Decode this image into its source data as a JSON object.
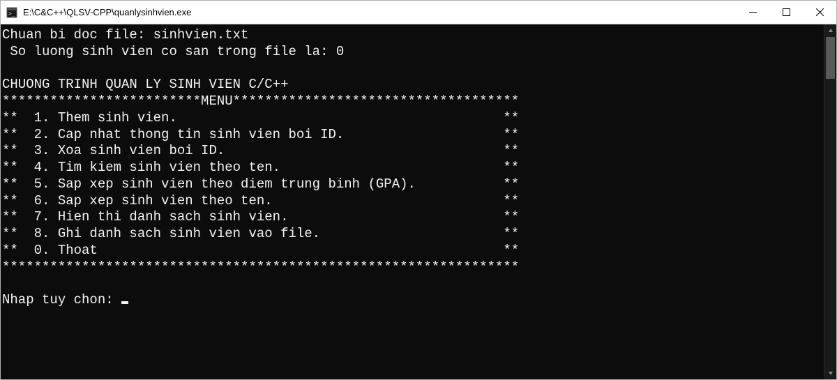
{
  "window": {
    "title": "E:\\C&C++\\QLSV-CPP\\quanlysinhvien.exe"
  },
  "console": {
    "line_prepare": "Chuan bi doc file: sinhvien.txt",
    "line_count": " So luong sinh vien co san trong file la: 0",
    "blank": "",
    "heading": "CHUONG TRINH QUAN LY SINH VIEN C/C++",
    "menu_top": "*************************MENU************************************",
    "menu_items": [
      "**  1. Them sinh vien.                                         **",
      "**  2. Cap nhat thong tin sinh vien boi ID.                    **",
      "**  3. Xoa sinh vien boi ID.                                   **",
      "**  4. Tim kiem sinh vien theo ten.                            **",
      "**  5. Sap xep sinh vien theo diem trung binh (GPA).           **",
      "**  6. Sap xep sinh vien theo ten.                             **",
      "**  7. Hien thi danh sach sinh vien.                           **",
      "**  8. Ghi danh sach sinh vien vao file.                       **",
      "**  0. Thoat                                                   **"
    ],
    "menu_bottom": "*****************************************************************",
    "prompt": "Nhap tuy chon: "
  }
}
